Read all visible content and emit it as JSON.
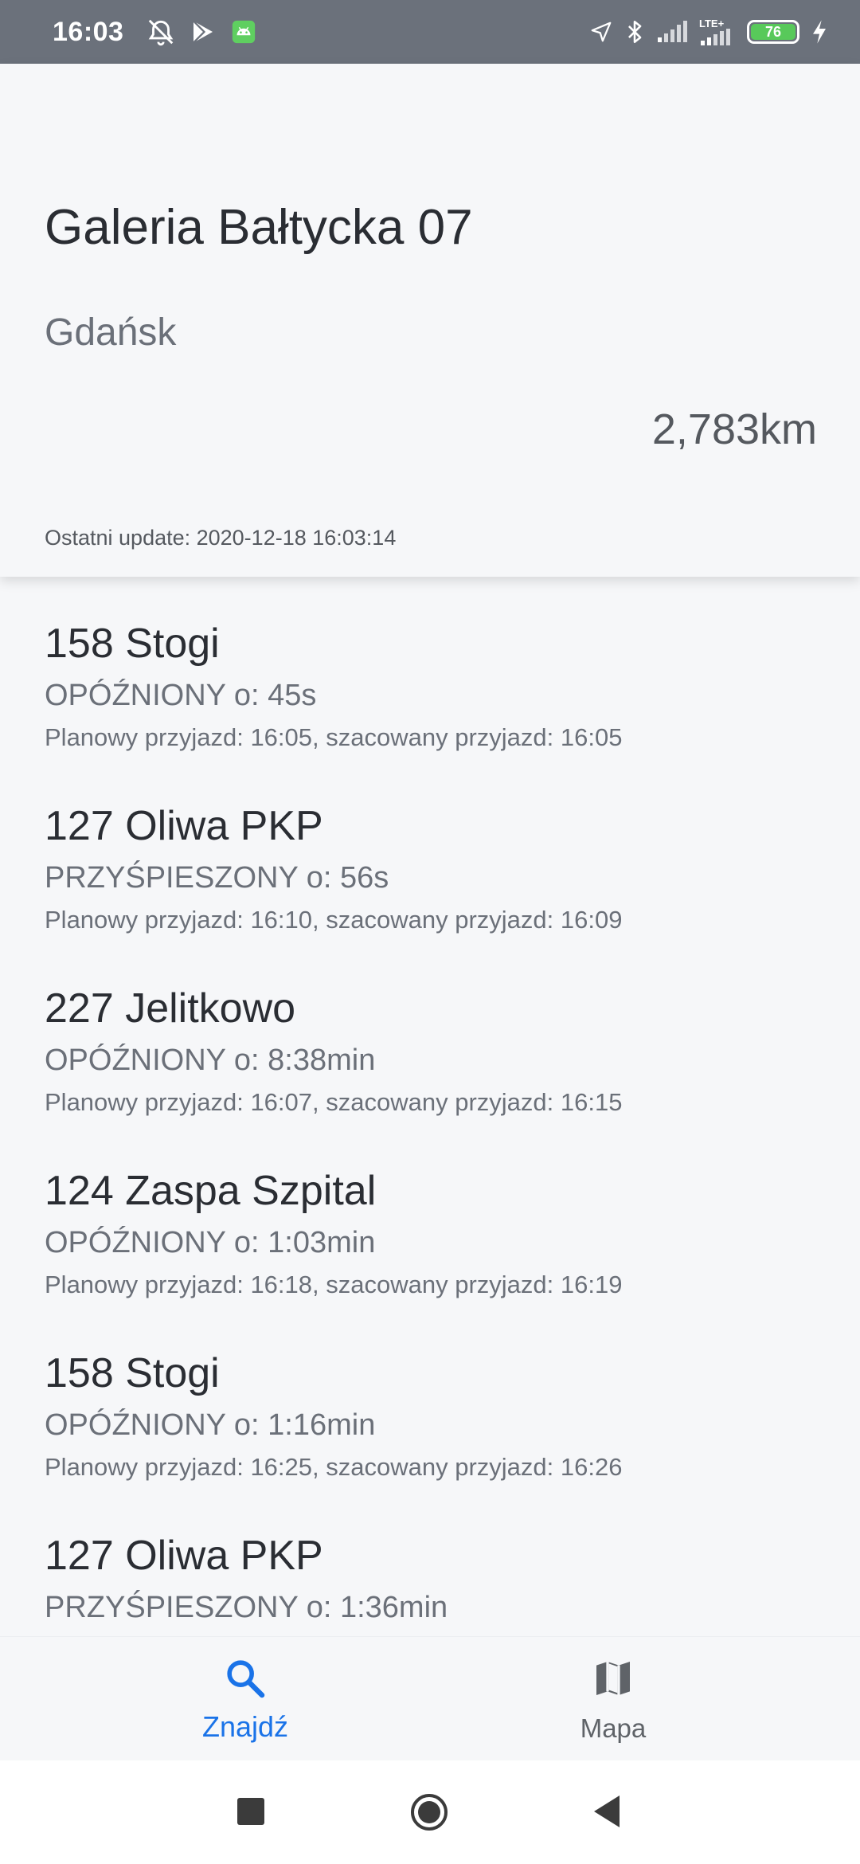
{
  "status_bar": {
    "time": "16:03",
    "battery_level": "76",
    "network_label": "LTE+",
    "icons": [
      "alarm-off-icon",
      "play-store-icon",
      "android-icon",
      "location-icon",
      "bluetooth-icon",
      "signal-icon",
      "lte-signal-icon",
      "battery-icon",
      "charging-icon"
    ],
    "bar_color": "#6b717b",
    "battery_color": "#58c95a"
  },
  "stop": {
    "name": "Galeria Bałtycka 07",
    "city": "Gdańsk",
    "distance": "2,783km",
    "last_update": "Ostatni update: 2020-12-18 16:03:14"
  },
  "departures": [
    {
      "title": "158 Stogi",
      "status": "OPÓŹNIONY o: 45s",
      "times": "Planowy przyjazd: 16:05, szacowany przyjazd: 16:05"
    },
    {
      "title": "127 Oliwa PKP",
      "status": "PRZYŚPIESZONY o: 56s",
      "times": "Planowy przyjazd: 16:10, szacowany przyjazd: 16:09"
    },
    {
      "title": "227 Jelitkowo",
      "status": "OPÓŹNIONY o: 8:38min",
      "times": "Planowy przyjazd: 16:07, szacowany przyjazd: 16:15"
    },
    {
      "title": "124 Zaspa Szpital",
      "status": "OPÓŹNIONY o: 1:03min",
      "times": "Planowy przyjazd: 16:18, szacowany przyjazd: 16:19"
    },
    {
      "title": "158 Stogi",
      "status": "OPÓŹNIONY o: 1:16min",
      "times": "Planowy przyjazd: 16:25, szacowany przyjazd: 16:26"
    },
    {
      "title": "127 Oliwa PKP",
      "status": "PRZYŚPIESZONY o: 1:36min",
      "times": ""
    }
  ],
  "bottom_nav": {
    "find_label": "Znajdź",
    "find_icon": "search-icon",
    "map_label": "Mapa",
    "map_icon": "map-icon",
    "active_color": "#1a73e8",
    "inactive_color": "#5f6368"
  },
  "system_nav": {
    "buttons": [
      "recent-apps-icon",
      "home-icon",
      "back-icon"
    ]
  }
}
